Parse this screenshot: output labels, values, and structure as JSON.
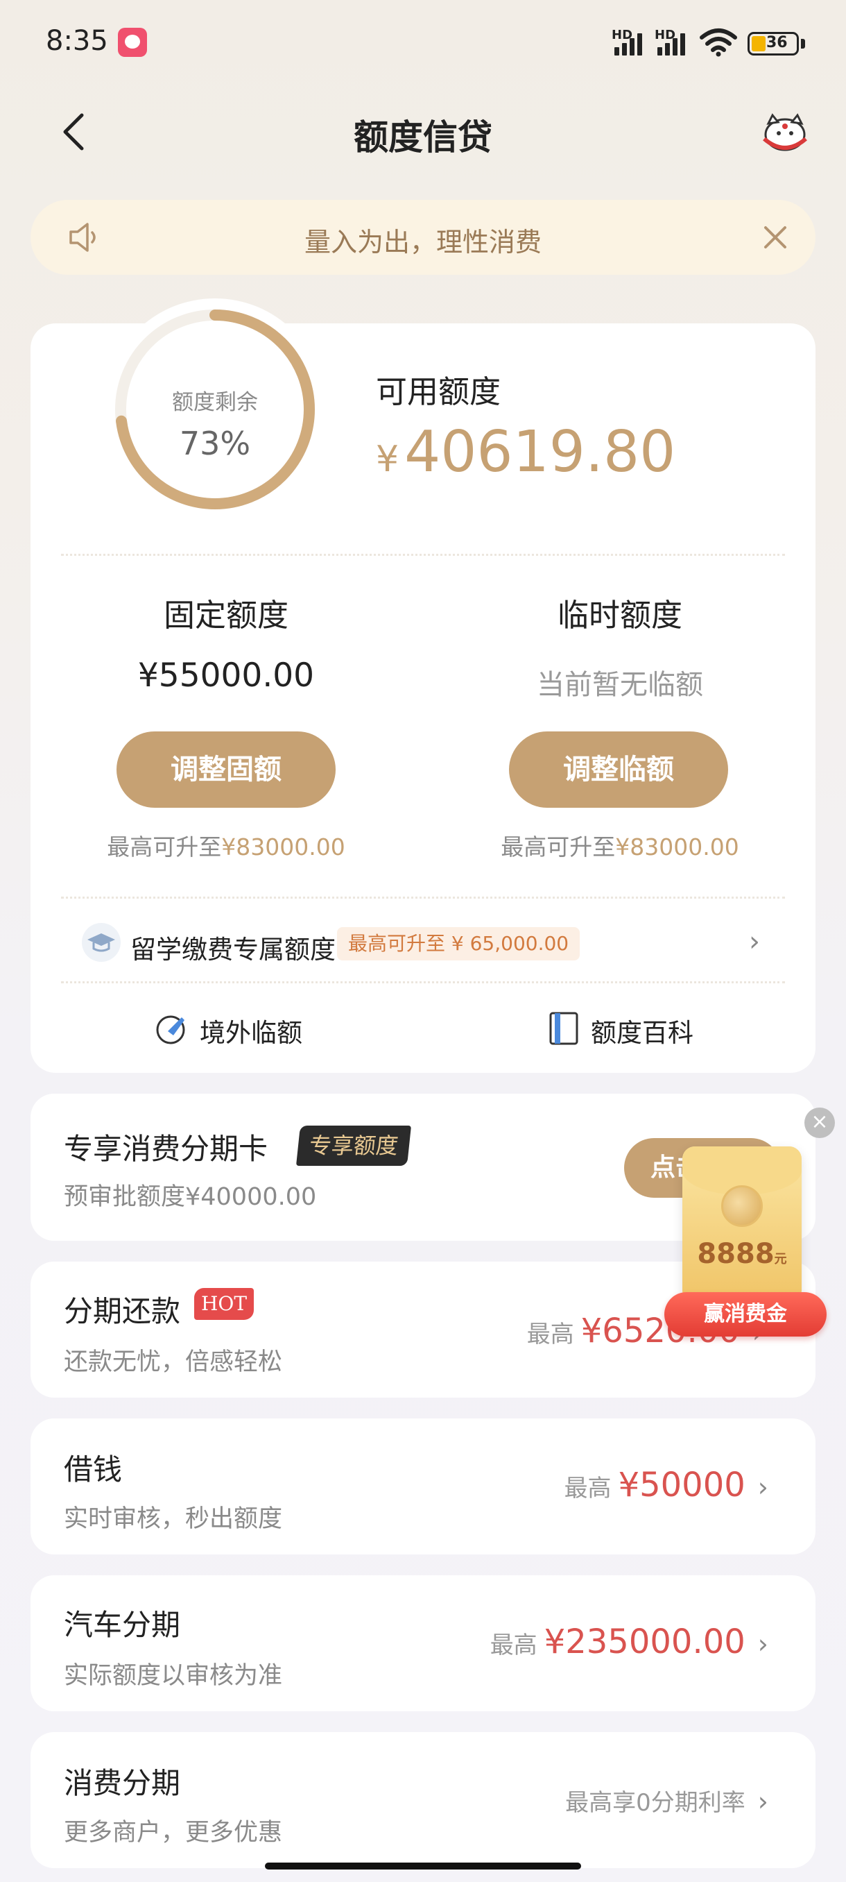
{
  "status_bar": {
    "time": "8:35",
    "signal_1": "HD",
    "signal_2": "HD",
    "battery": "36"
  },
  "header": {
    "title": "额度信贷"
  },
  "notice": {
    "text": "量入为出，理性消费"
  },
  "credit": {
    "remaining_label": "额度剩余",
    "remaining_percent": "73%",
    "remaining_fraction": 0.73,
    "available_label": "可用额度",
    "currency": "¥",
    "available_value": "40619.80",
    "fixed": {
      "title": "固定额度",
      "value": "¥55000.00",
      "button": "调整固额",
      "hint_prefix": "最高可升至",
      "hint_amount": "¥83000.00"
    },
    "temporary": {
      "title": "临时额度",
      "value": "当前暂无临额",
      "button": "调整临额",
      "hint_prefix": "最高可升至",
      "hint_amount": "¥83000.00"
    },
    "study": {
      "label": "留学缴费专属额度",
      "tag": "最高可升至 ¥ 65,000.00"
    },
    "tools": {
      "overseas": "境外临额",
      "wiki": "额度百科"
    }
  },
  "cards": {
    "exclusive": {
      "title": "专享消费分期卡",
      "tag": "专享额度",
      "sub": "预审批额度¥40000.00",
      "button": "点击"
    },
    "installment": {
      "title": "分期还款",
      "badge": "HOT",
      "sub": "还款无忧，倍感轻松",
      "prefix": "最高",
      "amount": "¥6520.00"
    },
    "loan": {
      "title": "借钱",
      "sub": "实时审核，秒出额度",
      "prefix": "最高",
      "amount": "¥50000"
    },
    "car": {
      "title": "汽车分期",
      "sub": "实际额度以审核为准",
      "prefix": "最高",
      "amount": "¥235000.00"
    },
    "consumer": {
      "title": "消费分期",
      "sub": "更多商户，更多优惠",
      "right": "最高享0分期利率"
    }
  },
  "float_promo": {
    "amount": "8888",
    "unit": "元",
    "label": "赢消费金"
  },
  "colors": {
    "gold": "#c6a173",
    "red_amount": "#d9534f",
    "notice_bg": "#fbf3e3"
  }
}
